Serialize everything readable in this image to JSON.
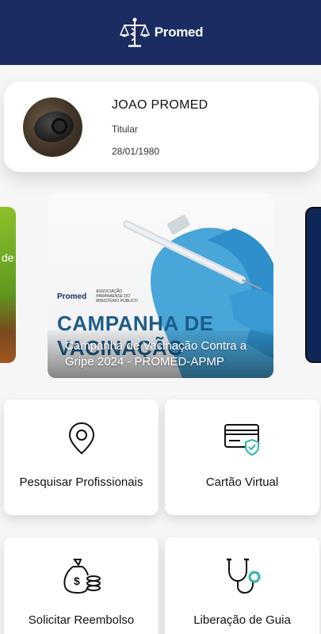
{
  "header": {
    "brand": "Promed",
    "background_color": "#1c2c62",
    "logo_icon": "caduceus-scales-icon"
  },
  "profile": {
    "name": "JOAO PROMED",
    "role": "Titular",
    "birth_date": "28/01/1980",
    "avatar_icon": "avatar-photo"
  },
  "carousel": {
    "left_peek_text": "de",
    "banner": {
      "logo_text": "Promed",
      "association_text": "Associação Paranaense do Ministério Público",
      "campaign_text": "CAMPANHA DE VACINAÇÃO",
      "caption": "Campanha de Vacinação Contra a Gripe 2024 - PROMED-APMP"
    }
  },
  "tiles": [
    {
      "label": "Pesquisar Profissionais",
      "icon": "location-pin-icon"
    },
    {
      "label": "Cartão Virtual",
      "icon": "virtual-card-shield-icon"
    },
    {
      "label": "Solicitar Reembolso",
      "icon": "money-bag-coins-icon"
    },
    {
      "label": "Liberação de Guia",
      "icon": "stethoscope-icon"
    }
  ],
  "accent_color": "#2bb5a6"
}
